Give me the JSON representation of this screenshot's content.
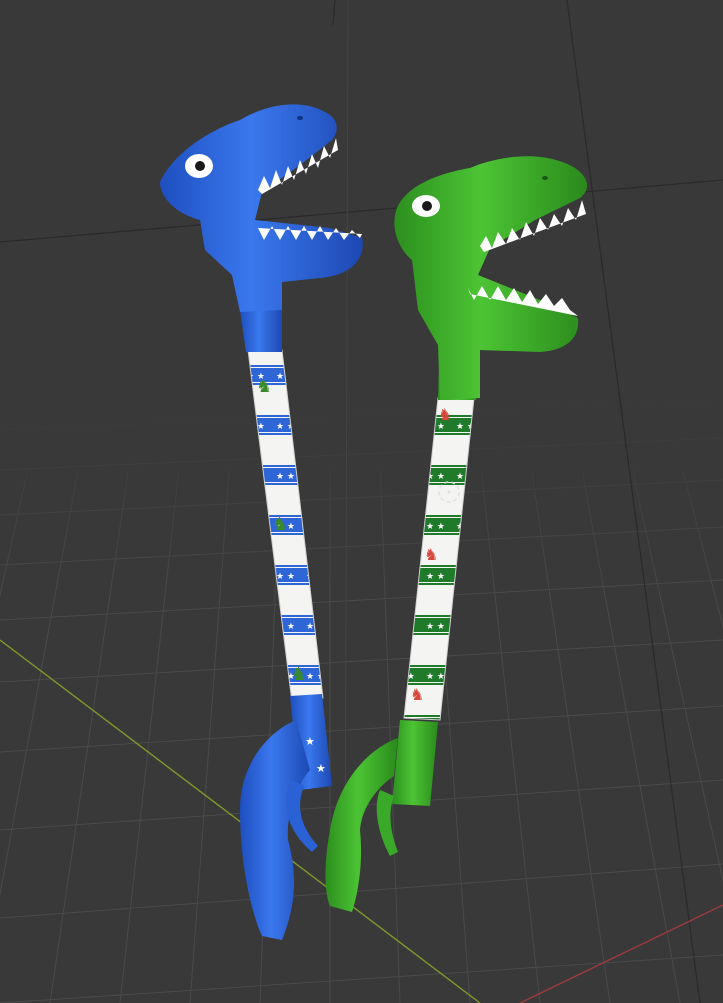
{
  "viewport": {
    "background": "#393939",
    "grid_color": "#4a4a4a",
    "x_axis_color": "#a03a3a",
    "y_axis_color": "#7f9a2a"
  },
  "objects": [
    {
      "name": "blue-dino-grabber",
      "color": "#2f6be0",
      "pattern_color": "#2e66d8"
    },
    {
      "name": "green-dino-grabber",
      "color": "#3fae2a",
      "pattern_color": "#1f7a2a"
    }
  ],
  "origin_marker": {
    "icon": "3d-cursor-icon",
    "color": "#e0e0e0"
  }
}
